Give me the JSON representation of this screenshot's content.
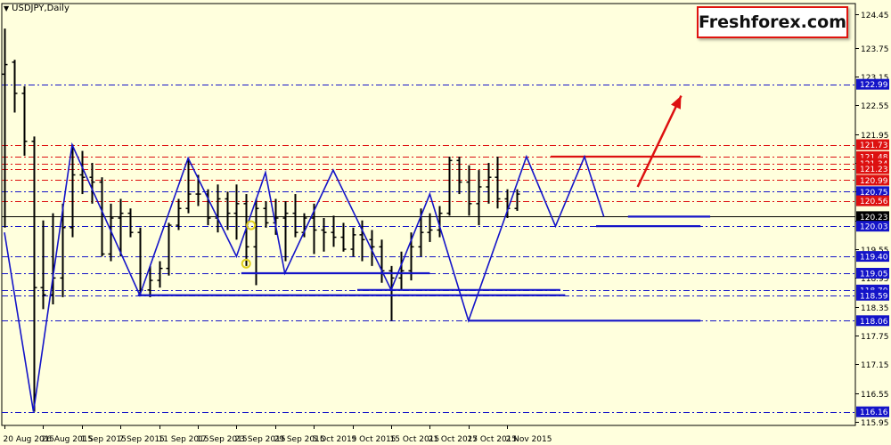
{
  "symbol_label": "USDJPY,Daily",
  "brand_label": "Freshforex.com",
  "colors": {
    "background": "#FFFFDD",
    "candles": "#000000",
    "zigzag": "#1414C8",
    "support": "#1414C8",
    "resistance": "#DD1010",
    "arrow": "#DD1010",
    "highlight": "#E0D020"
  },
  "chart_data": {
    "type": "ohlc",
    "symbol": "USDJPY",
    "timeframe": "Daily",
    "ylim": [
      115.95,
      124.45
    ],
    "y_ticks": [
      124.45,
      123.75,
      123.15,
      122.55,
      121.95,
      121.35,
      120.75,
      120.15,
      119.55,
      118.95,
      118.35,
      117.75,
      117.15,
      116.55,
      115.95
    ],
    "x_ticks": [
      "20 Aug 2015",
      "26 Aug 2015",
      "1 Sep 2015",
      "7 Sep 2015",
      "11 Sep 2015",
      "17 Sep 2015",
      "23 Sep 2015",
      "29 Sep 2015",
      "5 Oct 2015",
      "9 Oct 2015",
      "15 Oct 2015",
      "21 Oct 2015",
      "27 Oct 2015",
      "2 Nov 2015"
    ],
    "x_tick_index": [
      0,
      4,
      8,
      12,
      16,
      20,
      24,
      28,
      32,
      36,
      40,
      44,
      48,
      52
    ],
    "candles": [
      {
        "o": 123.2,
        "h": 124.15,
        "l": 120.0,
        "c": 123.4
      },
      {
        "o": 123.45,
        "h": 123.5,
        "l": 122.4,
        "c": 122.8
      },
      {
        "o": 122.8,
        "h": 122.95,
        "l": 121.5,
        "c": 121.8
      },
      {
        "o": 121.8,
        "h": 121.9,
        "l": 116.16,
        "c": 118.75
      },
      {
        "o": 118.75,
        "h": 120.15,
        "l": 118.3,
        "c": 118.6
      },
      {
        "o": 118.6,
        "h": 120.3,
        "l": 118.4,
        "c": 118.95
      },
      {
        "o": 118.95,
        "h": 120.5,
        "l": 118.55,
        "c": 120.0
      },
      {
        "o": 120.0,
        "h": 121.73,
        "l": 119.8,
        "c": 121.1
      },
      {
        "o": 121.1,
        "h": 121.6,
        "l": 120.7,
        "c": 121.05
      },
      {
        "o": 121.05,
        "h": 121.35,
        "l": 120.5,
        "c": 120.95
      },
      {
        "o": 120.95,
        "h": 121.05,
        "l": 119.4,
        "c": 119.45
      },
      {
        "o": 119.45,
        "h": 120.5,
        "l": 119.3,
        "c": 120.2
      },
      {
        "o": 120.2,
        "h": 120.6,
        "l": 119.4,
        "c": 120.3
      },
      {
        "o": 120.3,
        "h": 120.4,
        "l": 119.8,
        "c": 119.9
      },
      {
        "o": 119.9,
        "h": 120.0,
        "l": 118.6,
        "c": 118.7
      },
      {
        "o": 118.7,
        "h": 119.2,
        "l": 118.55,
        "c": 118.9
      },
      {
        "o": 118.9,
        "h": 119.3,
        "l": 118.75,
        "c": 119.15
      },
      {
        "o": 119.15,
        "h": 120.1,
        "l": 119.0,
        "c": 120.05
      },
      {
        "o": 120.05,
        "h": 120.6,
        "l": 119.95,
        "c": 120.4
      },
      {
        "o": 120.4,
        "h": 121.45,
        "l": 120.3,
        "c": 120.7
      },
      {
        "o": 120.7,
        "h": 121.1,
        "l": 120.45,
        "c": 120.7
      },
      {
        "o": 120.7,
        "h": 120.8,
        "l": 120.05,
        "c": 120.2
      },
      {
        "o": 120.2,
        "h": 120.9,
        "l": 119.9,
        "c": 120.6
      },
      {
        "o": 120.6,
        "h": 120.75,
        "l": 119.95,
        "c": 120.3
      },
      {
        "o": 120.3,
        "h": 120.9,
        "l": 119.75,
        "c": 120.5
      },
      {
        "o": 120.5,
        "h": 120.7,
        "l": 119.2,
        "c": 119.6
      },
      {
        "o": 119.6,
        "h": 120.6,
        "l": 118.8,
        "c": 120.4
      },
      {
        "o": 120.4,
        "h": 120.55,
        "l": 120.0,
        "c": 120.1
      },
      {
        "o": 120.1,
        "h": 120.6,
        "l": 119.85,
        "c": 120.2
      },
      {
        "o": 120.2,
        "h": 120.55,
        "l": 119.3,
        "c": 120.3
      },
      {
        "o": 120.3,
        "h": 120.7,
        "l": 119.8,
        "c": 119.9
      },
      {
        "o": 119.9,
        "h": 120.3,
        "l": 119.8,
        "c": 120.2
      },
      {
        "o": 120.2,
        "h": 120.5,
        "l": 119.45,
        "c": 119.95
      },
      {
        "o": 119.95,
        "h": 120.2,
        "l": 119.5,
        "c": 119.9
      },
      {
        "o": 119.9,
        "h": 120.25,
        "l": 119.6,
        "c": 119.8
      },
      {
        "o": 119.8,
        "h": 120.1,
        "l": 119.5,
        "c": 119.55
      },
      {
        "o": 119.55,
        "h": 120.0,
        "l": 119.4,
        "c": 119.85
      },
      {
        "o": 119.85,
        "h": 120.15,
        "l": 119.3,
        "c": 119.75
      },
      {
        "o": 119.75,
        "h": 119.95,
        "l": 119.2,
        "c": 119.6
      },
      {
        "o": 119.6,
        "h": 119.75,
        "l": 118.85,
        "c": 119.1
      },
      {
        "o": 119.1,
        "h": 119.2,
        "l": 118.06,
        "c": 118.95
      },
      {
        "o": 118.95,
        "h": 119.5,
        "l": 118.7,
        "c": 119.1
      },
      {
        "o": 119.1,
        "h": 119.9,
        "l": 118.9,
        "c": 119.6
      },
      {
        "o": 119.6,
        "h": 120.4,
        "l": 119.4,
        "c": 119.9
      },
      {
        "o": 119.9,
        "h": 120.3,
        "l": 119.7,
        "c": 119.95
      },
      {
        "o": 119.95,
        "h": 120.45,
        "l": 119.8,
        "c": 120.3
      },
      {
        "o": 120.3,
        "h": 121.48,
        "l": 120.25,
        "c": 121.4
      },
      {
        "o": 121.4,
        "h": 121.48,
        "l": 120.7,
        "c": 120.95
      },
      {
        "o": 120.95,
        "h": 121.3,
        "l": 120.25,
        "c": 120.5
      },
      {
        "o": 120.5,
        "h": 121.2,
        "l": 120.05,
        "c": 120.85
      },
      {
        "o": 120.85,
        "h": 121.35,
        "l": 120.5,
        "c": 121.05
      },
      {
        "o": 121.05,
        "h": 121.48,
        "l": 120.4,
        "c": 120.6
      },
      {
        "o": 120.6,
        "h": 120.8,
        "l": 120.2,
        "c": 120.4
      },
      {
        "o": 120.4,
        "h": 120.8,
        "l": 120.35,
        "c": 120.7
      }
    ],
    "zigzag": [
      {
        "i": 0,
        "price": 119.9
      },
      {
        "i": 3,
        "price": 116.16
      },
      {
        "i": 7,
        "price": 121.73
      },
      {
        "i": 14,
        "price": 118.59
      },
      {
        "i": 19,
        "price": 121.45
      },
      {
        "i": 24,
        "price": 119.4
      },
      {
        "i": 27,
        "price": 121.15
      },
      {
        "i": 29,
        "price": 119.05
      },
      {
        "i": 34,
        "price": 121.2
      },
      {
        "i": 40,
        "price": 118.7
      },
      {
        "i": 44,
        "price": 120.7
      },
      {
        "i": 48,
        "price": 118.06
      },
      {
        "i": 54,
        "price": 121.48
      },
      {
        "i": 57,
        "price": 120.03
      },
      {
        "i": 60,
        "price": 121.48
      },
      {
        "i": 62,
        "price": 120.23
      }
    ],
    "support_lines": [
      {
        "price": 119.05,
        "from": 24.5,
        "to": 44.0
      },
      {
        "price": 118.7,
        "from": 36.5,
        "to": 57.5
      },
      {
        "price": 118.59,
        "from": 13.8,
        "to": 58.0
      },
      {
        "price": 118.06,
        "from": 48.0,
        "to": 72.0
      },
      {
        "price": 120.03,
        "from": 61.2,
        "to": 72.0
      },
      {
        "price": 120.23,
        "from": 64.5,
        "to": 73.0
      }
    ],
    "resistance_lines": [
      {
        "price": 121.48,
        "from": 56.5,
        "to": 72.0
      }
    ],
    "price_levels": [
      {
        "price": 122.99,
        "label": "122.99",
        "color": "#1414C8",
        "style": "dashdot"
      },
      {
        "price": 121.73,
        "label": "121.73",
        "color": "#DD1010",
        "style": "dashdot"
      },
      {
        "price": 121.48,
        "label": "121.48",
        "color": "#DD1010",
        "style": "dashdot"
      },
      {
        "price": 121.34,
        "label": "121.34",
        "color": "#DD1010",
        "style": "dashdot"
      },
      {
        "price": 121.23,
        "label": "121.23",
        "color": "#DD1010",
        "style": "dashdot"
      },
      {
        "price": 120.99,
        "label": "120.99",
        "color": "#DD1010",
        "style": "dashdot"
      },
      {
        "price": 120.75,
        "label": "120.75",
        "color": "#1414C8",
        "style": "dashdot"
      },
      {
        "price": 120.56,
        "label": "120.56",
        "color": "#DD1010",
        "style": "dashdot"
      },
      {
        "price": 120.23,
        "label": "120.23",
        "color": "#000000",
        "style": "solid"
      },
      {
        "price": 120.03,
        "label": "120.03",
        "color": "#1414C8",
        "style": "dashdot"
      },
      {
        "price": 119.4,
        "label": "119.40",
        "color": "#1414C8",
        "style": "dashdot"
      },
      {
        "price": 119.05,
        "label": "119.05",
        "color": "#1414C8",
        "style": "dashdot"
      },
      {
        "price": 118.7,
        "label": "118.70",
        "color": "#1414C8",
        "style": "dashdot"
      },
      {
        "price": 118.59,
        "label": "118.59",
        "color": "#1414C8",
        "style": "dashdot"
      },
      {
        "price": 118.06,
        "label": "118.06",
        "color": "#1414C8",
        "style": "dashdot"
      },
      {
        "price": 116.16,
        "label": "116.16",
        "color": "#1414C8",
        "style": "dashdot"
      }
    ],
    "arrow": {
      "from": {
        "i": 65.5,
        "price": 120.85
      },
      "to": {
        "i": 70.0,
        "price": 122.75
      }
    },
    "highlight_circles": [
      {
        "i": 25.5,
        "price": 120.05
      },
      {
        "i": 25.0,
        "price": 119.25
      }
    ]
  }
}
